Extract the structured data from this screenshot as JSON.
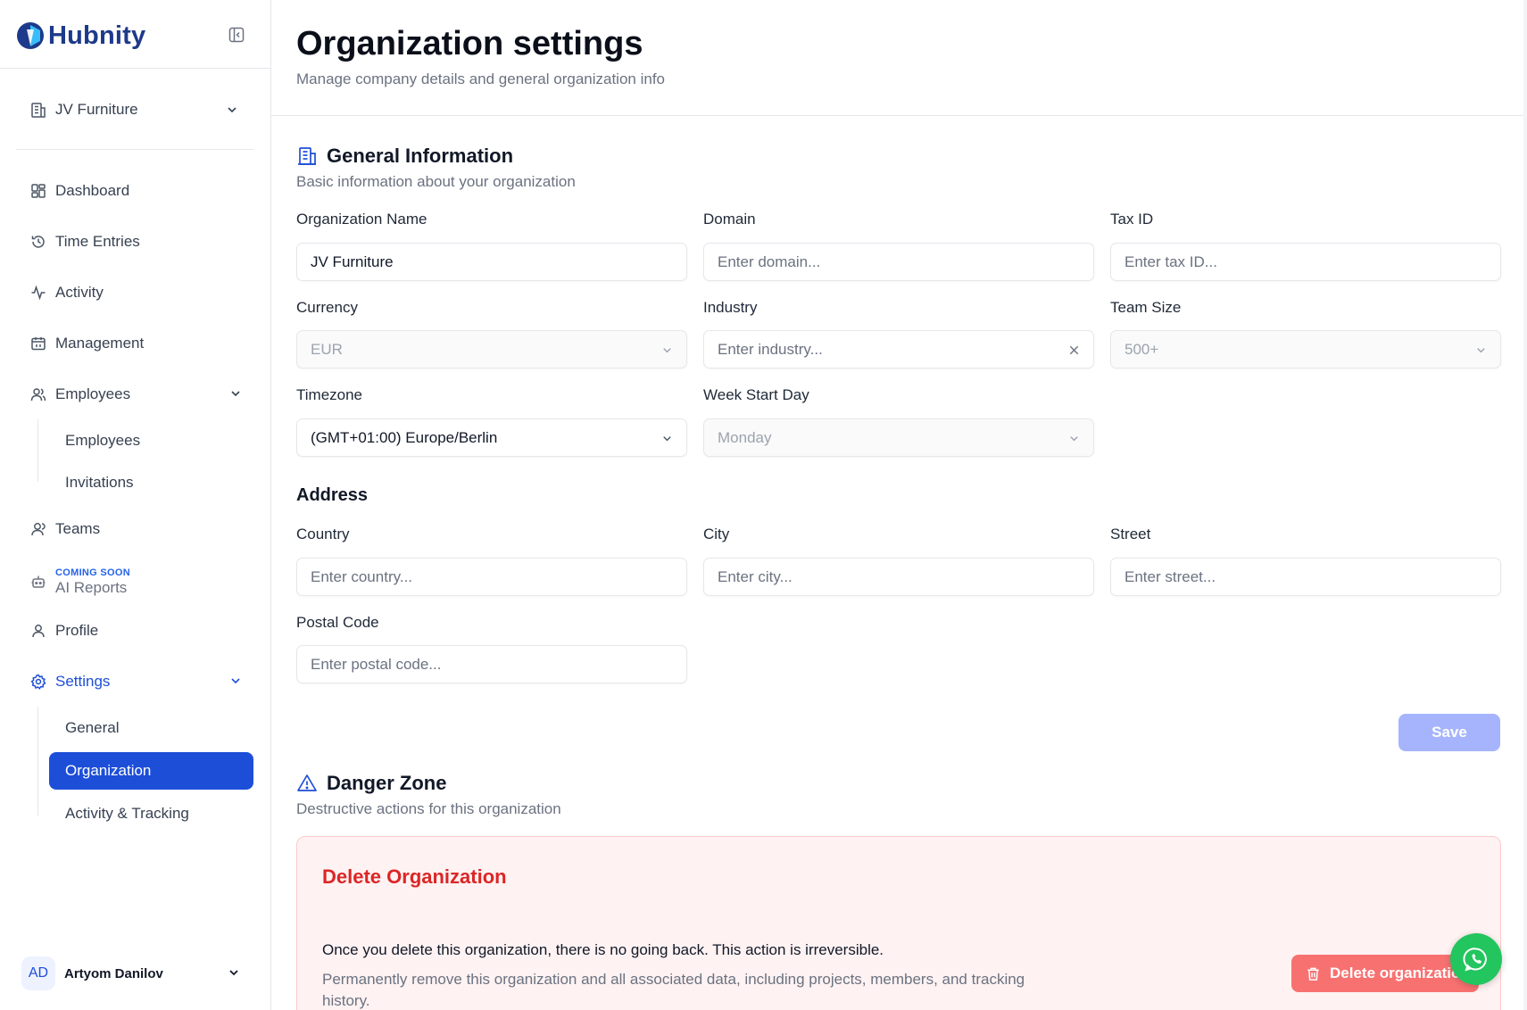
{
  "app": {
    "brand": "Hubnity"
  },
  "sidebar": {
    "org_selector": "JV Furniture",
    "nav": {
      "dashboard": "Dashboard",
      "time_entries": "Time Entries",
      "activity": "Activity",
      "management": "Management",
      "employees": "Employees",
      "employees_sub": [
        "Employees",
        "Invitations"
      ],
      "teams": "Teams",
      "ai_reports": {
        "badge": "COMING SOON",
        "label": "AI Reports"
      },
      "profile": "Profile",
      "settings": "Settings",
      "settings_sub": [
        "General",
        "Organization",
        "Activity & Tracking"
      ]
    },
    "active_item": "Organization",
    "user": {
      "initials": "AD",
      "name": "Artyom Danilov"
    }
  },
  "page": {
    "title": "Organization settings",
    "subtitle": "Manage company details and general organization info"
  },
  "general": {
    "title": "General Information",
    "subtitle": "Basic information about your organization",
    "fields": {
      "org_name": {
        "label": "Organization Name",
        "value": "JV Furniture"
      },
      "domain": {
        "label": "Domain",
        "placeholder": "Enter domain..."
      },
      "tax_id": {
        "label": "Tax ID",
        "placeholder": "Enter tax ID..."
      },
      "currency": {
        "label": "Currency",
        "value": "EUR"
      },
      "industry": {
        "label": "Industry",
        "placeholder": "Enter industry..."
      },
      "team_size": {
        "label": "Team Size",
        "value": "500+"
      },
      "timezone": {
        "label": "Timezone",
        "value": "(GMT+01:00) Europe/Berlin"
      },
      "week_start": {
        "label": "Week Start Day",
        "value": "Monday"
      }
    },
    "address": {
      "title": "Address",
      "country": {
        "label": "Country",
        "placeholder": "Enter country..."
      },
      "city": {
        "label": "City",
        "placeholder": "Enter city..."
      },
      "street": {
        "label": "Street",
        "placeholder": "Enter street..."
      },
      "postal": {
        "label": "Postal Code",
        "placeholder": "Enter postal code..."
      }
    },
    "save_label": "Save"
  },
  "danger": {
    "title": "Danger Zone",
    "subtitle": "Destructive actions for this organization",
    "card_title": "Delete Organization",
    "warning": "Once you delete this organization, there is no going back. This action is irreversible.",
    "description": "Permanently remove this organization and all associated data, including projects, members, and tracking history.",
    "delete_label": "Delete organization"
  },
  "colors": {
    "primary": "#1d4ed8",
    "brand_text": "#1e3a8a",
    "danger": "#dc2626",
    "danger_bg": "#fef2f2",
    "save_disabled": "#a5b4fc",
    "whatsapp": "#22c55e"
  },
  "icons": {
    "collapse": "sidebar-collapse-icon",
    "whatsapp": "whatsapp-icon"
  }
}
